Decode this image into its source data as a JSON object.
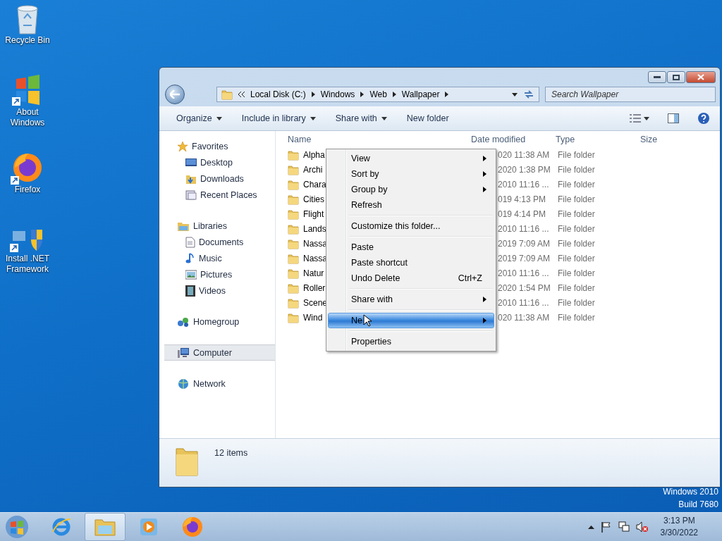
{
  "desktop_icons": [
    {
      "label": "Recycle Bin",
      "kind": "bin"
    },
    {
      "label": "About Windows",
      "kind": "about"
    },
    {
      "label": "Firefox",
      "kind": "firefox"
    },
    {
      "label": "Install .NET Framework",
      "kind": "installer"
    }
  ],
  "window": {
    "address": {
      "segments": [
        "Local Disk (C:)",
        "Windows",
        "Web",
        "Wallpaper"
      ]
    },
    "search": {
      "placeholder": "Search Wallpaper"
    },
    "toolbar": [
      {
        "label": "Organize",
        "dropdown": true
      },
      {
        "label": "Include in library",
        "dropdown": true
      },
      {
        "label": "Share with",
        "dropdown": true
      },
      {
        "label": "New folder",
        "dropdown": false
      }
    ],
    "sidebar": {
      "groups": [
        {
          "label": "Favorites",
          "kind": "favorites",
          "selected": false,
          "children": [
            {
              "label": "Desktop",
              "kind": "desktop",
              "selected": false
            },
            {
              "label": "Downloads",
              "kind": "downloads",
              "selected": false
            },
            {
              "label": "Recent Places",
              "kind": "recent",
              "selected": false
            }
          ]
        },
        {
          "label": "Libraries",
          "kind": "libraries",
          "selected": false,
          "children": [
            {
              "label": "Documents",
              "kind": "documents",
              "selected": false
            },
            {
              "label": "Music",
              "kind": "music",
              "selected": false
            },
            {
              "label": "Pictures",
              "kind": "pictures",
              "selected": false
            },
            {
              "label": "Videos",
              "kind": "videos",
              "selected": false
            }
          ]
        },
        {
          "label": "Homegroup",
          "kind": "homegroup",
          "selected": false
        },
        {
          "label": "Computer",
          "kind": "computer",
          "selected": true
        },
        {
          "label": "Network",
          "kind": "network",
          "selected": false
        }
      ]
    },
    "table": {
      "columns": [
        "Name",
        "Date modified",
        "Type",
        "Size"
      ],
      "rows": [
        {
          "name": "Alpha",
          "date": "020 11:38 AM",
          "type": "File folder"
        },
        {
          "name": "Archi",
          "date": "2020 1:38 PM",
          "type": "File folder"
        },
        {
          "name": "Chara",
          "date": "2010 11:16 ...",
          "type": "File folder"
        },
        {
          "name": "Cities",
          "date": "019 4:13 PM",
          "type": "File folder"
        },
        {
          "name": "Flight",
          "date": "019 4:14 PM",
          "type": "File folder"
        },
        {
          "name": "Lands",
          "date": "2010 11:16 ...",
          "type": "File folder"
        },
        {
          "name": "Nassa",
          "date": "2019 7:09 AM",
          "type": "File folder"
        },
        {
          "name": "Nassa",
          "date": "2019 7:09 AM",
          "type": "File folder"
        },
        {
          "name": "Natur",
          "date": "2010 11:16 ...",
          "type": "File folder"
        },
        {
          "name": "Roller",
          "date": "2020 1:54 PM",
          "type": "File folder"
        },
        {
          "name": "Scene",
          "date": "2010 11:16 ...",
          "type": "File folder"
        },
        {
          "name": "Wind",
          "date": "020 11:38 AM",
          "type": "File folder"
        }
      ]
    },
    "context_menu": [
      {
        "kind": "item",
        "label": "View",
        "submenu": true,
        "selected": false
      },
      {
        "kind": "item",
        "label": "Sort by",
        "submenu": true,
        "selected": false
      },
      {
        "kind": "item",
        "label": "Group by",
        "submenu": true,
        "selected": false
      },
      {
        "kind": "item",
        "label": "Refresh",
        "submenu": false,
        "selected": false
      },
      {
        "kind": "separator"
      },
      {
        "kind": "item",
        "label": "Customize this folder...",
        "submenu": false,
        "selected": false
      },
      {
        "kind": "separator"
      },
      {
        "kind": "item",
        "label": "Paste",
        "submenu": false,
        "selected": false
      },
      {
        "kind": "item",
        "label": "Paste shortcut",
        "submenu": false,
        "selected": false
      },
      {
        "kind": "item",
        "label": "Undo Delete",
        "shortcut": "Ctrl+Z",
        "submenu": false,
        "selected": false
      },
      {
        "kind": "separator"
      },
      {
        "kind": "item",
        "label": "Share with",
        "submenu": true,
        "selected": false
      },
      {
        "kind": "separator"
      },
      {
        "kind": "item",
        "label": "Ne",
        "submenu": true,
        "selected": true
      },
      {
        "kind": "separator"
      },
      {
        "kind": "item",
        "label": "Properties",
        "submenu": false,
        "selected": false
      }
    ],
    "details": {
      "count": "12 items"
    }
  },
  "watermark": [
    "Windows 2010",
    "Build 7680"
  ],
  "taskbar": {
    "apps": [
      {
        "kind": "ie",
        "selected": false
      },
      {
        "kind": "explorer",
        "selected": true
      },
      {
        "kind": "media",
        "selected": false
      },
      {
        "kind": "firefox",
        "selected": false
      }
    ],
    "clock": {
      "time": "3:13 PM",
      "date": "3/30/2022"
    }
  }
}
